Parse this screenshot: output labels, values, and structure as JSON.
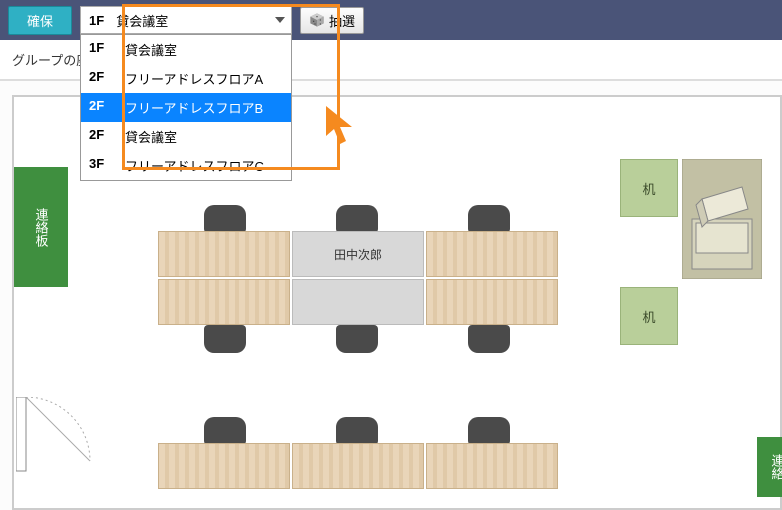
{
  "toolbar": {
    "confirm_label": "確保",
    "lottery_label": "抽選"
  },
  "dropdown": {
    "selected_floor": "1F",
    "selected_name": "貸会議室",
    "options": [
      {
        "floor": "1F",
        "name": "貸会議室"
      },
      {
        "floor": "2F",
        "name": "フリーアドレスフロアA"
      },
      {
        "floor": "2F",
        "name": "フリーアドレスフロアB"
      },
      {
        "floor": "2F",
        "name": "貸会議室"
      },
      {
        "floor": "3F",
        "name": "フリーアドレスフロアC"
      }
    ],
    "highlighted_index": 2
  },
  "subbar": {
    "text_prefix": "グループの座席を"
  },
  "floor": {
    "board_label_left": "連絡板",
    "board_label_right": "連絡",
    "desk_label": "机",
    "occupied_seat_name": "田中次郎"
  },
  "colors": {
    "accent_blue": "#0a84ff",
    "highlight_orange": "#f58a1f",
    "brand_teal": "#2fb0c4",
    "board_green": "#3f8f3f"
  }
}
